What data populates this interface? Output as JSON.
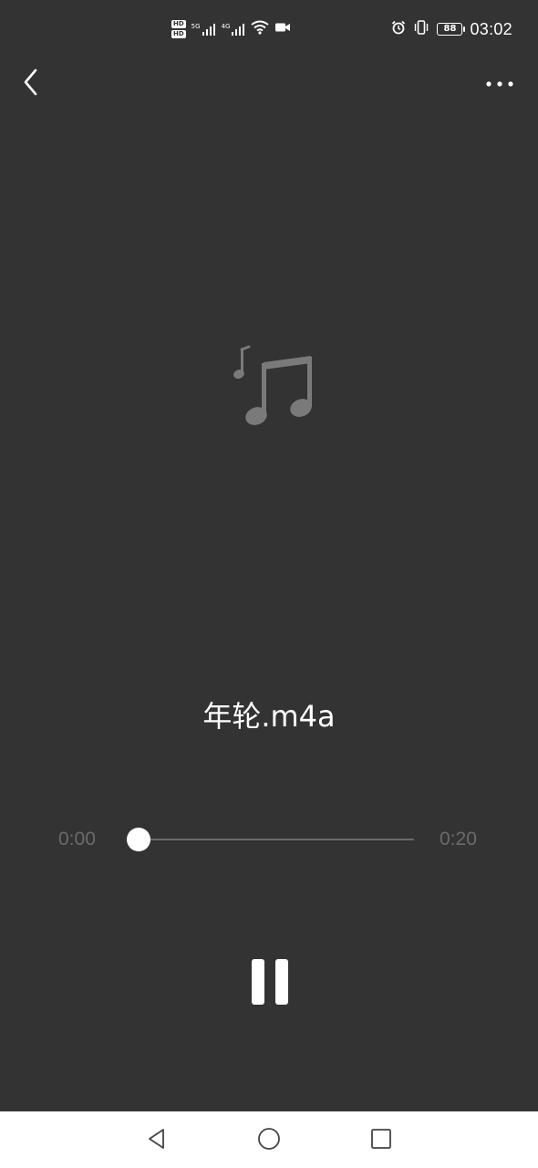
{
  "status_bar": {
    "hd_badges": [
      "HD",
      "HD"
    ],
    "signal_1_tag": "5G",
    "signal_2_tag": "4G",
    "battery_level": "88",
    "time": "03:02"
  },
  "app_bar": {
    "back_icon": "chevron-left-icon",
    "more_icon": "more-horizontal-icon"
  },
  "player": {
    "artwork_icon": "music-note-icon",
    "track_title": "年轮.m4a",
    "current_time": "0:00",
    "total_time": "0:20",
    "progress_fraction": 0,
    "state_icon": "pause-icon"
  },
  "nav_bar": {
    "back_icon": "triangle-back-icon",
    "home_icon": "circle-home-icon",
    "recents_icon": "square-recents-icon"
  }
}
